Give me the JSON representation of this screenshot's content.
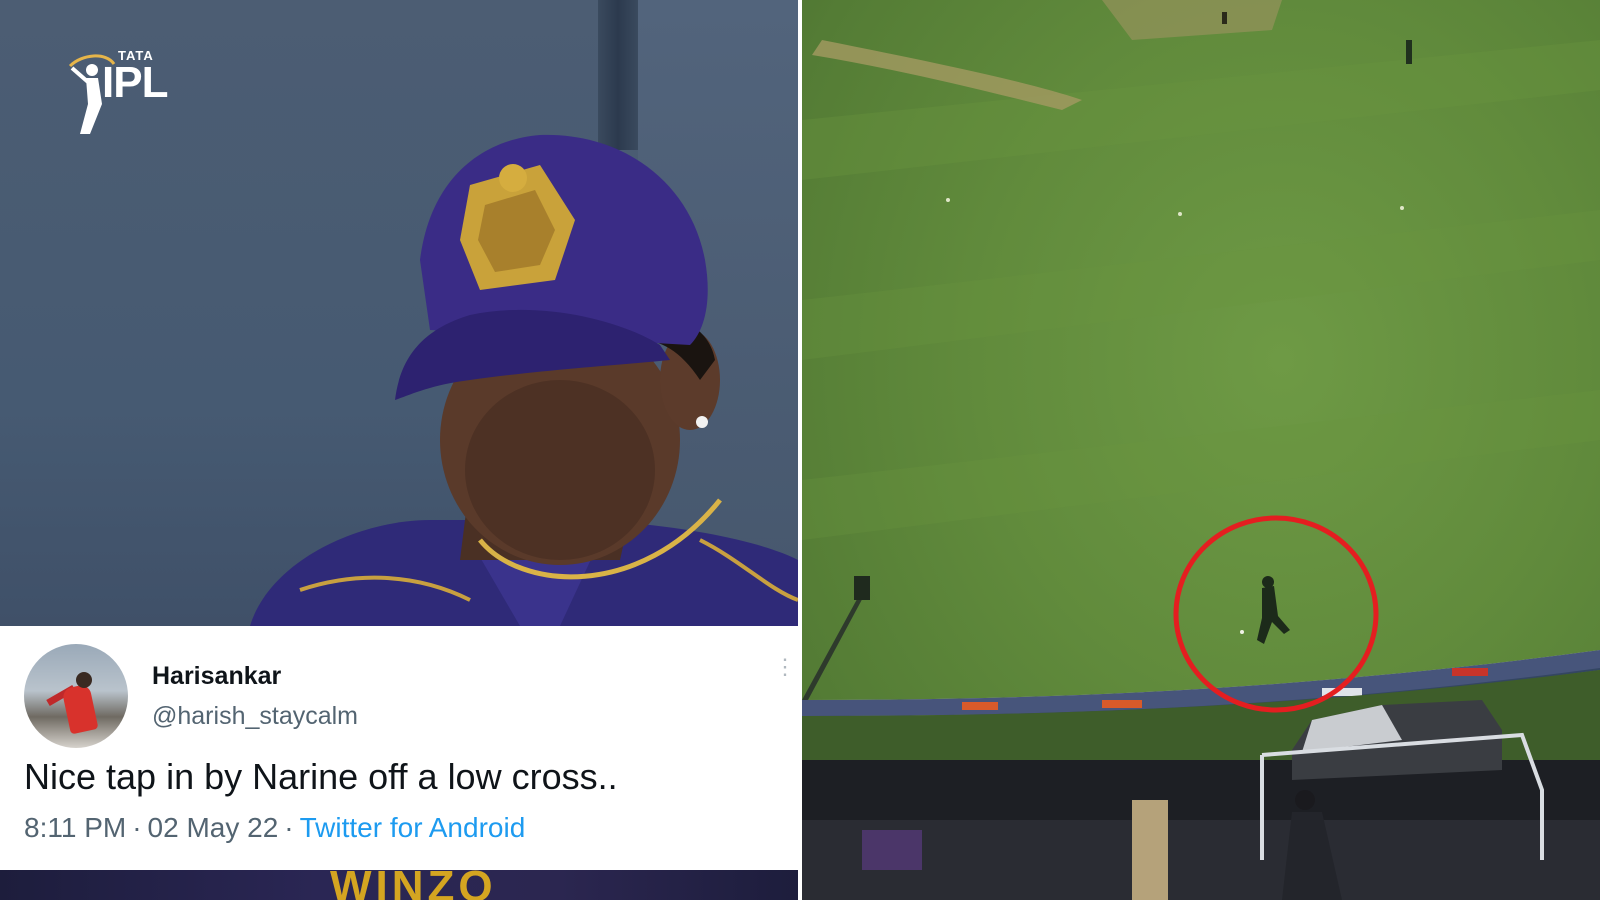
{
  "broadcast": {
    "logo_top": "TATA",
    "logo_main": "IPL"
  },
  "tweet": {
    "name": "Harisankar",
    "handle": "@harish_staycalm",
    "text": "Nice tap in by Narine off a low cross..",
    "time": "8:11 PM",
    "date": "02 May 22",
    "separator": "·",
    "source": "Twitter for Android",
    "more_icon": "⋮"
  },
  "shirt_sponsor": "WINZO",
  "colors": {
    "highlight_circle": "#e41e20",
    "kkr_purple": "#3b2a7a",
    "twitter_blue": "#1d9bf0"
  }
}
